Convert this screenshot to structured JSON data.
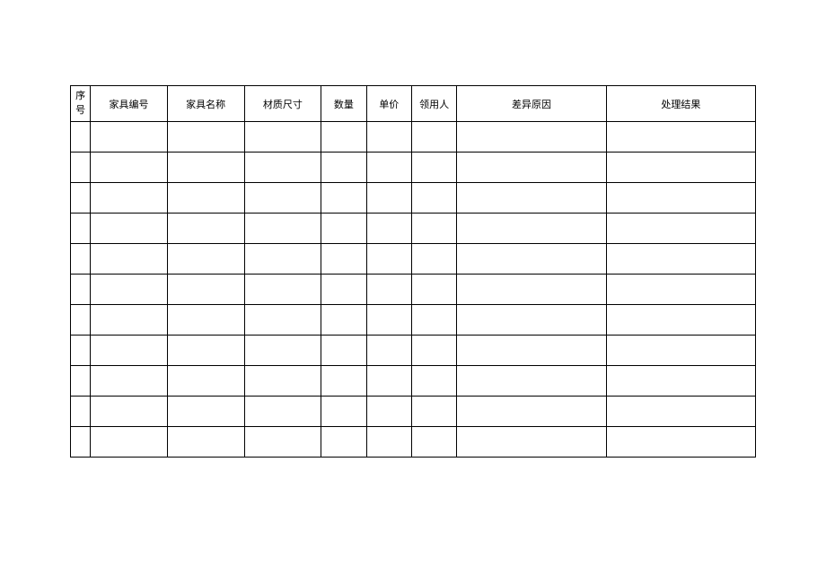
{
  "table": {
    "headers": {
      "seq": "序号",
      "code": "家具编号",
      "name": "家具名称",
      "spec": "材质尺寸",
      "qty": "数量",
      "price": "单价",
      "user": "领用人",
      "reason": "差异原因",
      "result": "处理结果"
    },
    "rows": [
      {
        "seq": "",
        "code": "",
        "name": "",
        "spec": "",
        "qty": "",
        "price": "",
        "user": "",
        "reason": "",
        "result": ""
      },
      {
        "seq": "",
        "code": "",
        "name": "",
        "spec": "",
        "qty": "",
        "price": "",
        "user": "",
        "reason": "",
        "result": ""
      },
      {
        "seq": "",
        "code": "",
        "name": "",
        "spec": "",
        "qty": "",
        "price": "",
        "user": "",
        "reason": "",
        "result": ""
      },
      {
        "seq": "",
        "code": "",
        "name": "",
        "spec": "",
        "qty": "",
        "price": "",
        "user": "",
        "reason": "",
        "result": ""
      },
      {
        "seq": "",
        "code": "",
        "name": "",
        "spec": "",
        "qty": "",
        "price": "",
        "user": "",
        "reason": "",
        "result": ""
      },
      {
        "seq": "",
        "code": "",
        "name": "",
        "spec": "",
        "qty": "",
        "price": "",
        "user": "",
        "reason": "",
        "result": ""
      },
      {
        "seq": "",
        "code": "",
        "name": "",
        "spec": "",
        "qty": "",
        "price": "",
        "user": "",
        "reason": "",
        "result": ""
      },
      {
        "seq": "",
        "code": "",
        "name": "",
        "spec": "",
        "qty": "",
        "price": "",
        "user": "",
        "reason": "",
        "result": ""
      },
      {
        "seq": "",
        "code": "",
        "name": "",
        "spec": "",
        "qty": "",
        "price": "",
        "user": "",
        "reason": "",
        "result": ""
      },
      {
        "seq": "",
        "code": "",
        "name": "",
        "spec": "",
        "qty": "",
        "price": "",
        "user": "",
        "reason": "",
        "result": ""
      },
      {
        "seq": "",
        "code": "",
        "name": "",
        "spec": "",
        "qty": "",
        "price": "",
        "user": "",
        "reason": "",
        "result": ""
      }
    ]
  }
}
